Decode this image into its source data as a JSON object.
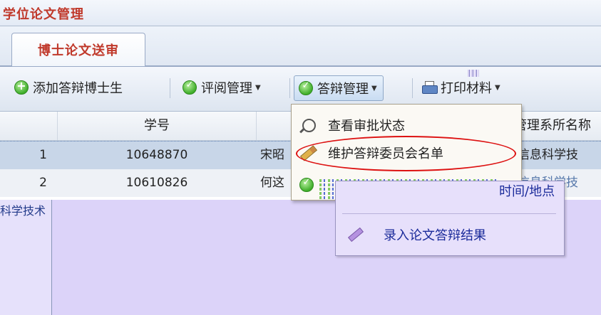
{
  "app": {
    "title": "学位论文管理"
  },
  "tabs": [
    {
      "label": "博士论文送审",
      "active": true
    }
  ],
  "toolbar": {
    "add_label": "添加答辩博士生",
    "review_label": "评阅管理",
    "defense_label": "答辩管理",
    "print_label": "打印材料"
  },
  "grid": {
    "columns": {
      "index": "",
      "student_id": "学号",
      "name": "",
      "dept": "管理系所名称"
    },
    "rows": [
      {
        "index": "1",
        "student_id": "10648870",
        "name": "宋昭",
        "dept": "信息科学技"
      },
      {
        "index": "2",
        "student_id": "10610826",
        "name": "何这",
        "dept": "信息科学技"
      }
    ],
    "partial_dept": "信息科学技",
    "lower_left_text": "科学技术"
  },
  "defense_menu": {
    "items": [
      {
        "label": "查看审批状态",
        "icon": "magnifier-icon"
      },
      {
        "label": "维护答辩委员会名单",
        "icon": "pencil-icon",
        "circled": true
      },
      {
        "label": "时间/地点",
        "icon": "check-icon"
      }
    ]
  },
  "submenu": {
    "schedule_label": "时间/地点",
    "result_label": "录入论文答辩结果"
  },
  "colors": {
    "accent_red": "#c0392b",
    "menu_bg": "#fbf9f4",
    "lower_panel": "#dcd3f9",
    "annotation": "#d11111"
  }
}
